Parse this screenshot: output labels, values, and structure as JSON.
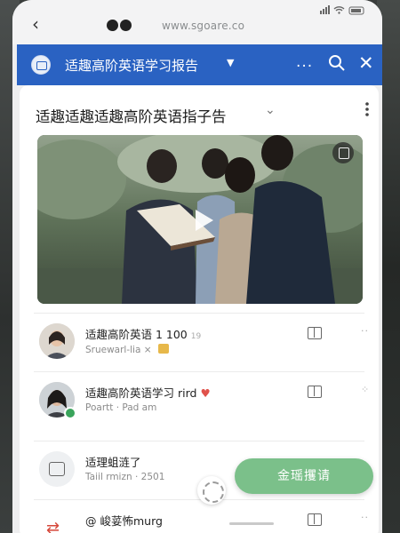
{
  "browser": {
    "url": "www.sgoare.co"
  },
  "appbar": {
    "title": "适趣高阶英语学习报告",
    "more_label": "...",
    "accent": "#2a62c2"
  },
  "card": {
    "title": "适趣适趣适趣高阶英语指子告"
  },
  "items": [
    {
      "title": "适趣高阶英语 1 100",
      "title_suffix": "19",
      "subtitle": "Sruewarl-lia ×"
    },
    {
      "title": "适趣高阶英语学习 rird",
      "subtitle": "Poartt · Pad am"
    },
    {
      "title": "适理蛆涟了",
      "subtitle": "Taiil rmizn · 2501"
    },
    {
      "title": "@ 峻荽怖murg",
      "subtitle": ""
    }
  ],
  "fab": {
    "label": "金瑶攫请"
  },
  "colors": {
    "fab": "#7bc08a",
    "badge": "#3aa45b",
    "heart": "#e0524b"
  },
  "icons": [
    "back-arrow-icon",
    "app-calendar-icon",
    "caret-down-icon",
    "search-icon",
    "close-icon",
    "chevron-down-icon",
    "kebab-icon",
    "play-icon",
    "bookmark-icon",
    "book-icon",
    "more-dots-icon",
    "heart-icon",
    "swap-arrows-icon"
  ]
}
